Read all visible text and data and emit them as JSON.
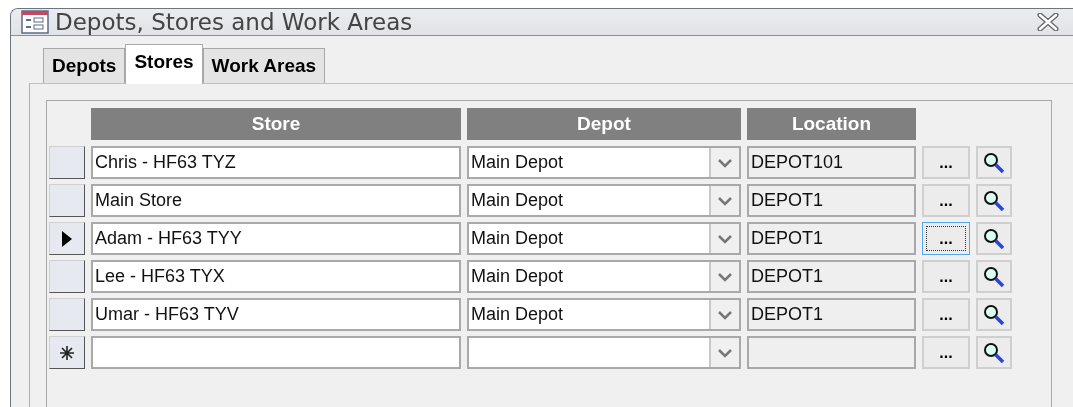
{
  "window": {
    "title": "Depots, Stores and Work Areas"
  },
  "tabs": [
    {
      "label": "Depots",
      "selected": false
    },
    {
      "label": "Stores",
      "selected": true
    },
    {
      "label": "Work Areas",
      "selected": false
    }
  ],
  "table": {
    "columns": [
      "Store",
      "Depot",
      "Location"
    ],
    "rows": [
      {
        "kind": "record",
        "selected": false,
        "store": "Chris - HF63 TYZ",
        "depot": "Main Depot",
        "location": "DEPOT101",
        "browse_button": "...",
        "browse_focused": false
      },
      {
        "kind": "record",
        "selected": false,
        "store": "Main Store",
        "depot": "Main Depot",
        "location": "DEPOT1",
        "browse_button": "...",
        "browse_focused": false
      },
      {
        "kind": "record",
        "selected": true,
        "store": "Adam - HF63 TYY",
        "depot": "Main Depot",
        "location": "DEPOT1",
        "browse_button": "...",
        "browse_focused": true
      },
      {
        "kind": "record",
        "selected": false,
        "store": "Lee - HF63 TYX",
        "depot": "Main Depot",
        "location": "DEPOT1",
        "browse_button": "...",
        "browse_focused": false
      },
      {
        "kind": "record",
        "selected": false,
        "store": "Umar - HF63 TYV",
        "depot": "Main Depot",
        "location": "DEPOT1",
        "browse_button": "...",
        "browse_focused": false
      },
      {
        "kind": "new",
        "selected": false,
        "browse_button": "...",
        "browse_focused": false
      }
    ]
  }
}
